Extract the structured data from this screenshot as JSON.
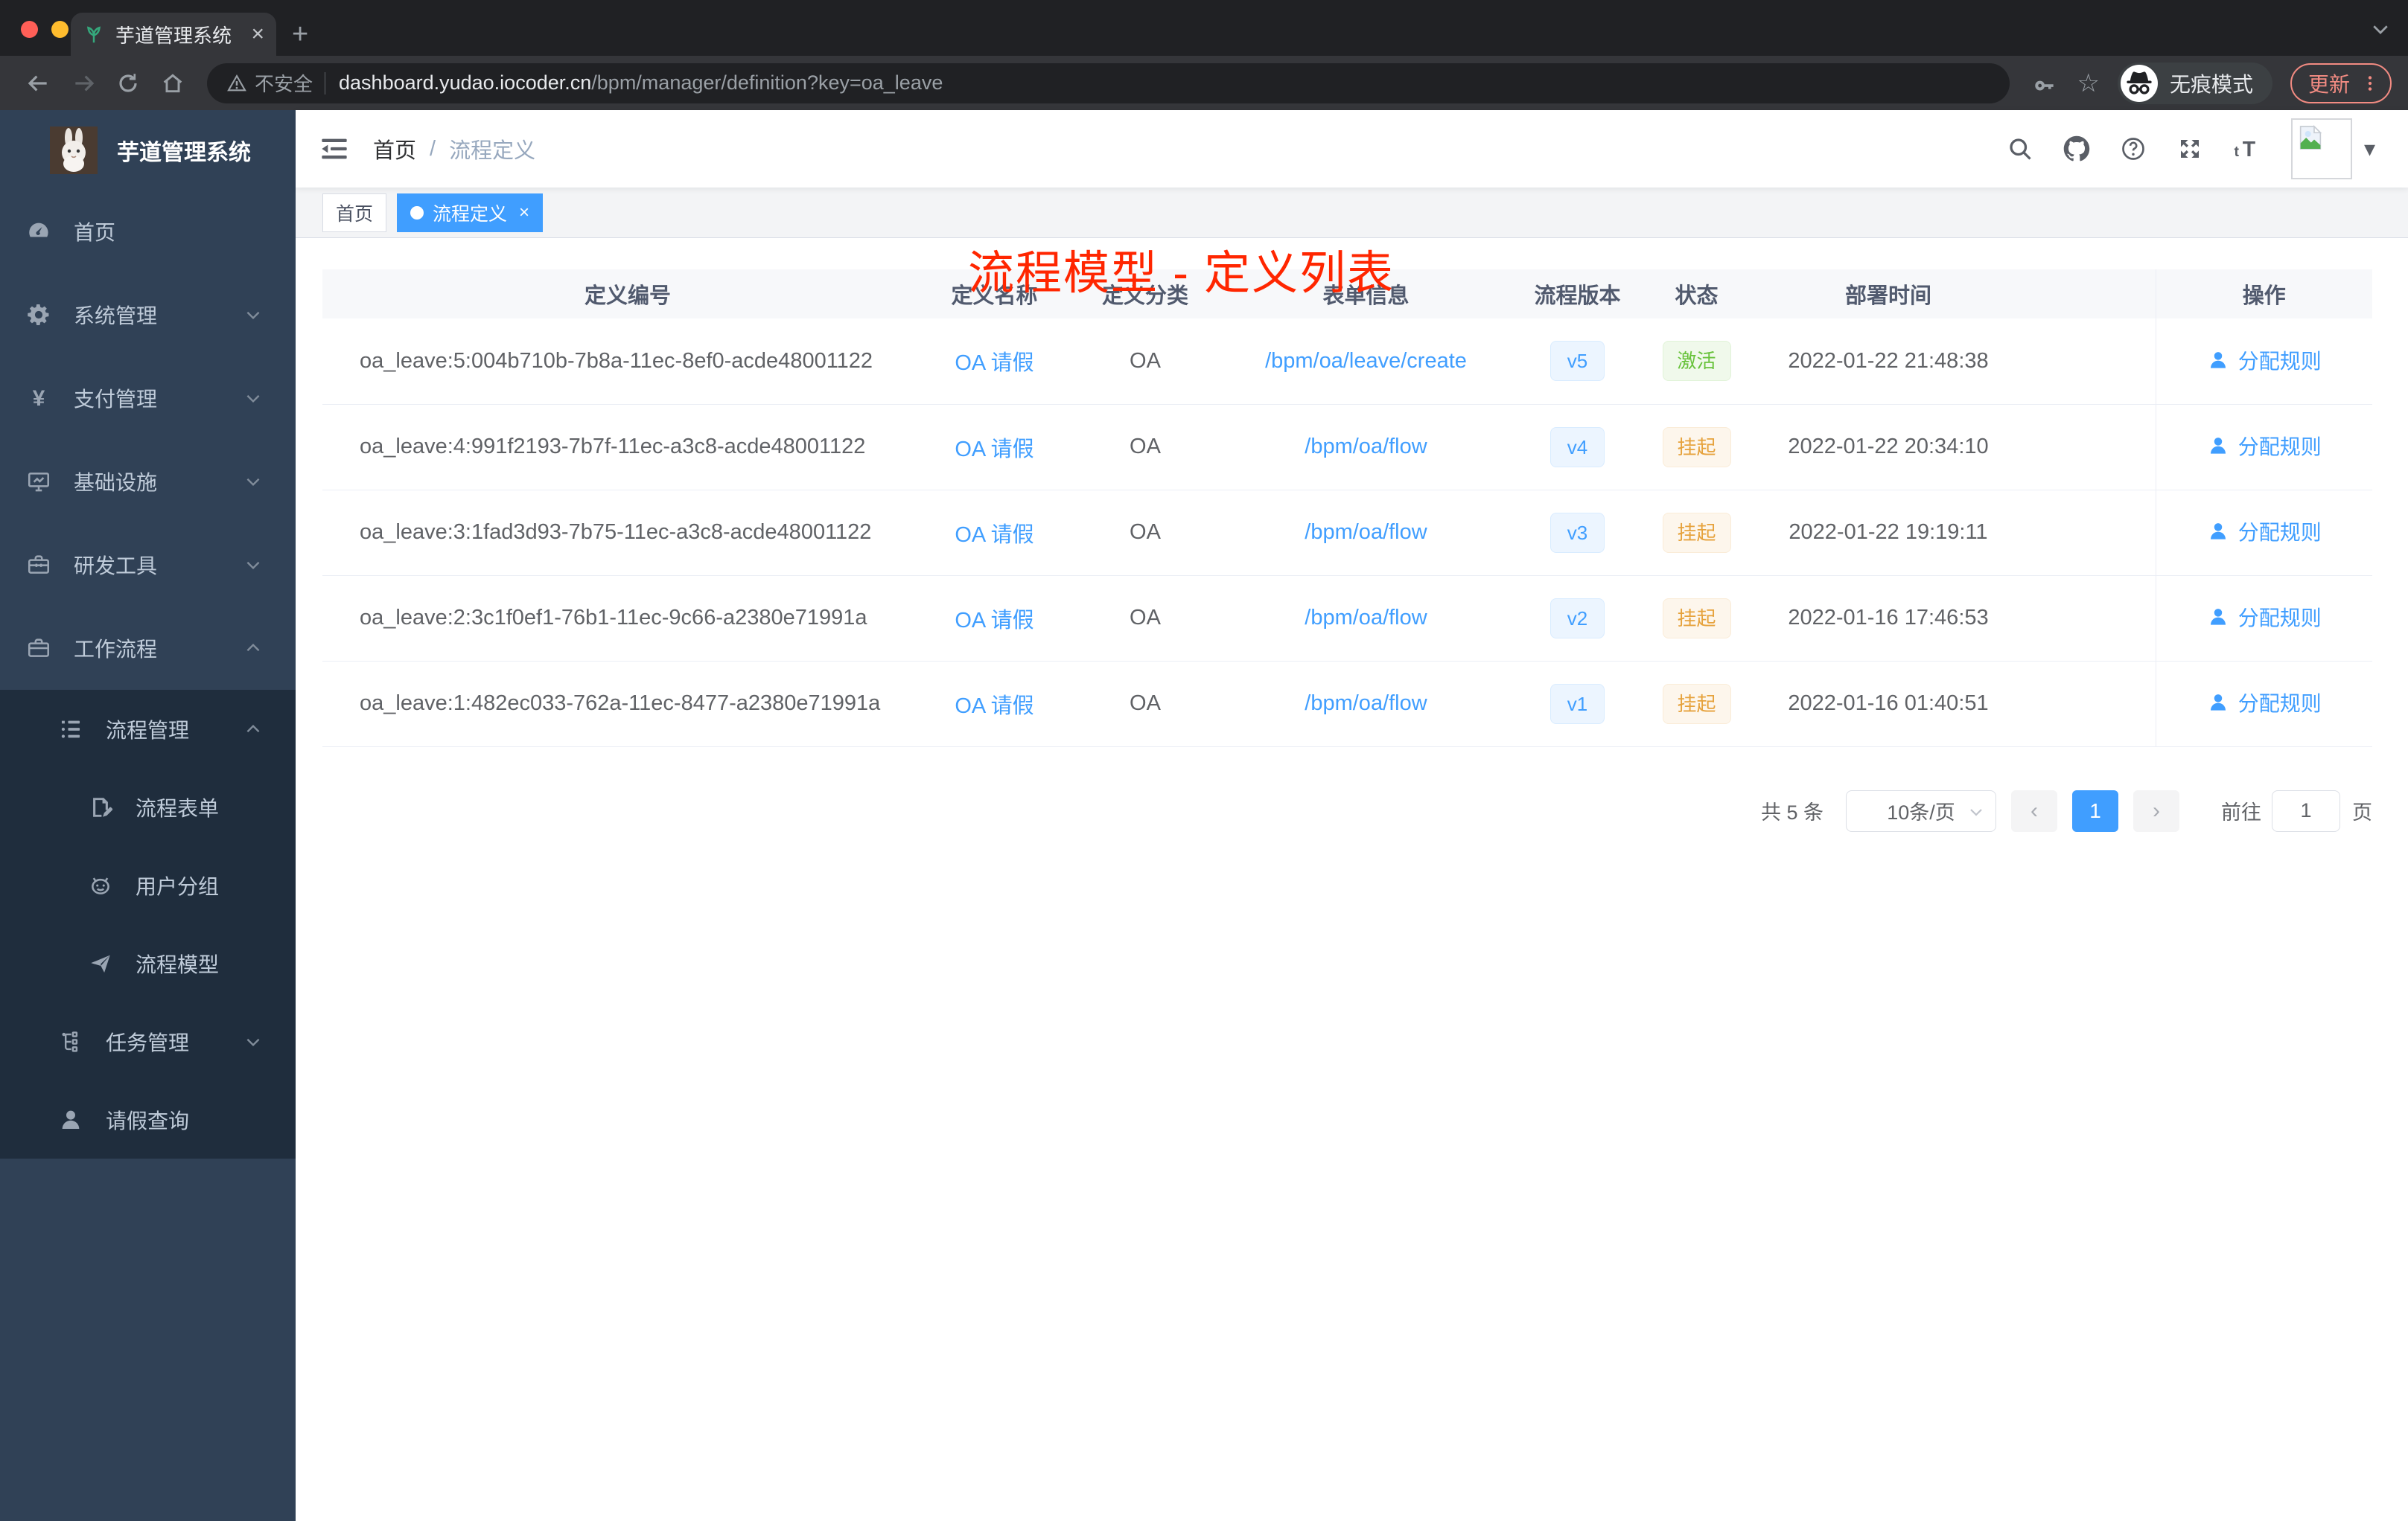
{
  "browser": {
    "tab_title": "芋道管理系统",
    "close_glyph": "×",
    "newtab_glyph": "+",
    "address": {
      "security_label": "不安全",
      "url_domain": "dashboard.yudao.iocoder.cn",
      "url_path": "/bpm/manager/definition?key=oa_leave"
    },
    "incognito_label": "无痕模式",
    "update_label": "更新"
  },
  "sidebar": {
    "logo_title": "芋道管理系统",
    "menu": [
      {
        "label": "首页",
        "icon": "dashboard-icon"
      },
      {
        "label": "系统管理",
        "icon": "gear-icon",
        "chevron": "chevron-down-icon"
      },
      {
        "label": "支付管理",
        "icon": "yen-icon",
        "chevron": "chevron-down-icon"
      },
      {
        "label": "基础设施",
        "icon": "monitor-icon",
        "chevron": "chevron-down-icon"
      },
      {
        "label": "研发工具",
        "icon": "toolbox-icon",
        "chevron": "chevron-down-icon"
      },
      {
        "label": "工作流程",
        "icon": "briefcase-icon",
        "chevron": "chevron-up-icon"
      }
    ],
    "submenu": [
      {
        "label": "流程管理",
        "icon": "tree-list-icon",
        "chevron": "chevron-up-icon",
        "level": "l1"
      },
      {
        "label": "流程表单",
        "icon": "form-edit-icon",
        "level": "l2"
      },
      {
        "label": "用户分组",
        "icon": "robot-face-icon",
        "level": "l2"
      },
      {
        "label": "流程模型",
        "icon": "paper-plane-icon",
        "level": "l2"
      },
      {
        "label": "任务管理",
        "icon": "task-tree-icon",
        "chevron": "chevron-down-icon",
        "level": "l1"
      },
      {
        "label": "请假查询",
        "icon": "user-icon",
        "level": "l1"
      }
    ]
  },
  "navbar": {
    "breadcrumb": {
      "home": "首页",
      "separator": "/",
      "current": "流程定义"
    }
  },
  "tags": [
    {
      "label": "首页"
    },
    {
      "label": "流程定义",
      "active": "active",
      "close_glyph": "×"
    }
  ],
  "annotation": {
    "text": "流程模型 - 定义列表",
    "color": "#ff2600"
  },
  "table": {
    "columns": [
      "定义编号",
      "定义名称",
      "定义分类",
      "表单信息",
      "流程版本",
      "状态",
      "部署时间",
      "操作"
    ],
    "rows": [
      {
        "id": "oa_leave:5:004b710b-7b8a-11ec-8ef0-acde48001122",
        "name": "OA 请假",
        "category": "OA",
        "form": "/bpm/oa/leave/create",
        "version": "v5",
        "status": "激活",
        "status_type": "success",
        "deploy_time": "2022-01-22 21:48:38",
        "action": "分配规则"
      },
      {
        "id": "oa_leave:4:991f2193-7b7f-11ec-a3c8-acde48001122",
        "name": "OA 请假",
        "category": "OA",
        "form": "/bpm/oa/flow",
        "version": "v4",
        "status": "挂起",
        "status_type": "warning",
        "deploy_time": "2022-01-22 20:34:10",
        "action": "分配规则"
      },
      {
        "id": "oa_leave:3:1fad3d93-7b75-11ec-a3c8-acde48001122",
        "name": "OA 请假",
        "category": "OA",
        "form": "/bpm/oa/flow",
        "version": "v3",
        "status": "挂起",
        "status_type": "warning",
        "deploy_time": "2022-01-22 19:19:11",
        "action": "分配规则"
      },
      {
        "id": "oa_leave:2:3c1f0ef1-76b1-11ec-9c66-a2380e71991a",
        "name": "OA 请假",
        "category": "OA",
        "form": "/bpm/oa/flow",
        "version": "v2",
        "status": "挂起",
        "status_type": "warning",
        "deploy_time": "2022-01-16 17:46:53",
        "action": "分配规则"
      },
      {
        "id": "oa_leave:1:482ec033-762a-11ec-8477-a2380e71991a",
        "name": "OA 请假",
        "category": "OA",
        "form": "/bpm/oa/flow",
        "version": "v1",
        "status": "挂起",
        "status_type": "warning",
        "deploy_time": "2022-01-16 01:40:51",
        "action": "分配规则"
      }
    ]
  },
  "pagination": {
    "total": "共 5 条",
    "page_size": "10条/页",
    "prev": "‹",
    "current": "1",
    "next": "›",
    "goto_label": "前往",
    "goto_value": "1",
    "unit": "页"
  },
  "colors": {
    "accent": "#409eff",
    "sidebar_bg": "#304156",
    "submenu_bg": "#1f2d3d",
    "sidebar_text": "#bfcbd9",
    "status_active": "#67c23a",
    "status_suspended": "#e6a23c",
    "annotation_red": "#ff2600",
    "chrome_dark": "#202124",
    "chrome_toolbar": "#35363a",
    "update_red": "#f28b82"
  }
}
